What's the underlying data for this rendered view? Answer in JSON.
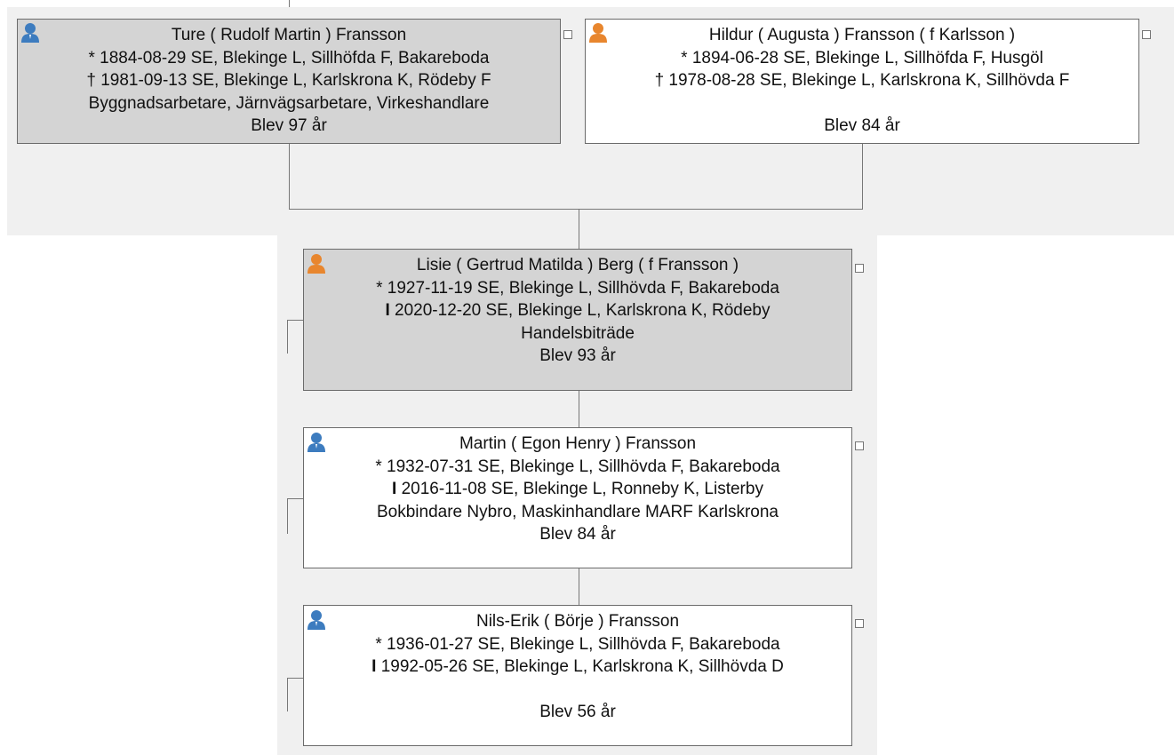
{
  "colors": {
    "panel": "#f0f0f0",
    "card_selected": "#d4d4d4",
    "card_normal": "#ffffff",
    "male_icon": "#3d7cbf",
    "female_icon": "#e8862e"
  },
  "parents": {
    "father": {
      "icon": "male-person-icon",
      "name": "Ture ( Rudolf Martin ) Fransson",
      "birth": "* 1884-08-29 SE, Blekinge L, Sillhöfda F, Bakareboda",
      "death": "† 1981-09-13 SE, Blekinge L, Karlskrona K, Rödeby F",
      "occupation": "Byggnadsarbetare, Järnvägsarbetare, Virkeshandlare",
      "age": "Blev 97 år"
    },
    "mother": {
      "icon": "female-person-icon",
      "name": "Hildur ( Augusta ) Fransson ( f Karlsson )",
      "birth": "* 1894-06-28 SE, Blekinge L, Sillhöfda F, Husgöl",
      "death": "† 1978-08-28 SE, Blekinge L, Karlskrona K, Sillhövda F",
      "occupation": "",
      "age": "Blev 84 år"
    }
  },
  "children": [
    {
      "icon": "female-person-icon",
      "name": "Lisie ( Gertrud Matilda ) Berg ( f Fransson )",
      "birth": "* 1927-11-19 SE, Blekinge L, Sillhövda F, Bakareboda",
      "burial_symbol": "I",
      "burial": "2020-12-20 SE, Blekinge L, Karlskrona K, Rödeby",
      "occupation": "Handelsbiträde",
      "age": "Blev 93 år"
    },
    {
      "icon": "male-person-icon",
      "name": "Martin ( Egon Henry ) Fransson",
      "birth": "* 1932-07-31 SE, Blekinge L, Sillhövda F, Bakareboda",
      "burial_symbol": "I",
      "burial": "2016-11-08 SE, Blekinge L, Ronneby K, Listerby",
      "occupation": "Bokbindare Nybro, Maskinhandlare MARF Karlskrona",
      "age": "Blev 84 år"
    },
    {
      "icon": "male-person-icon",
      "name": "Nils-Erik ( Börje ) Fransson",
      "birth": "* 1936-01-27 SE, Blekinge L, Sillhövda F, Bakareboda",
      "burial_symbol": "I",
      "burial": "1992-05-26 SE, Blekinge L, Karlskrona K, Sillhövda D",
      "occupation": "",
      "age": "Blev 56 år"
    }
  ]
}
